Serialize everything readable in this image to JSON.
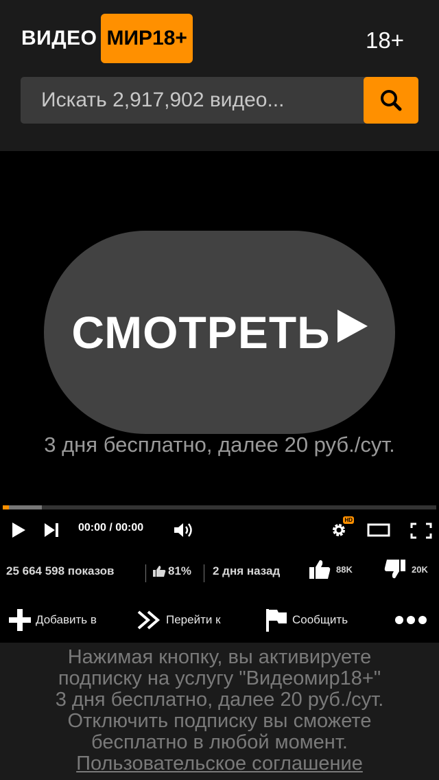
{
  "header": {
    "logo_left": "ВИДЕО",
    "logo_right": "МИР18+",
    "age_badge": "18+",
    "search_placeholder": "Искать 2,917,902 видео...",
    "accent_color": "#ff9000"
  },
  "video": {
    "watch_label": "СМОТРЕТЬ",
    "offer_text": "3 дня бесплатно, далее 20 руб./сут."
  },
  "player": {
    "time": "00:00 / 00:00",
    "hd_badge": "HD",
    "progress_buffered_fraction": 0.09,
    "progress_played_fraction": 0.015
  },
  "stats": {
    "views": "25 664 598 показов",
    "rating": "81%",
    "posted": "2 дня назад",
    "likes": "88K",
    "dislikes": "20K"
  },
  "actions": {
    "add": "Добавить в",
    "goto": "Перейти к",
    "report": "Сообщить",
    "more_icon": "more-dots-icon"
  },
  "disclaimer": {
    "line1": "Нажимая кнопку, вы активируете",
    "line2": "подписку на услугу \"Видеомир18+\"",
    "line3": "3 дня бесплатно, далее 20 руб./сут.",
    "line4": "Отключить подписку вы сможете",
    "line5": "бесплатно в любой момент.",
    "agreement_link": "Пользовательское соглашение"
  }
}
